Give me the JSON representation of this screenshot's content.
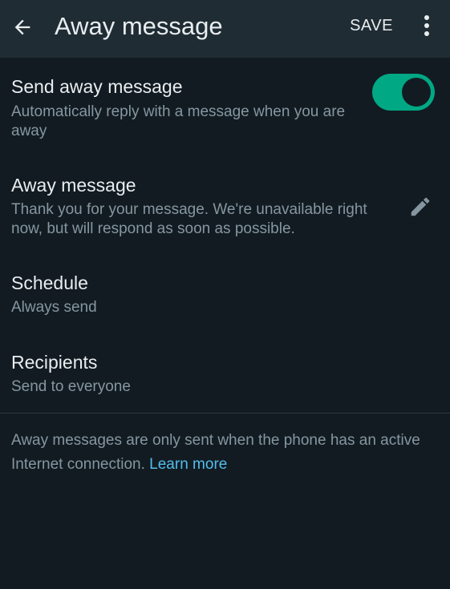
{
  "toolbar": {
    "back_icon": "arrow-left-icon",
    "title": "Away message",
    "save_label": "SAVE",
    "more_icon": "more-vertical-icon"
  },
  "send_away": {
    "title": "Send away message",
    "subtitle": "Automatically reply with a message when you are away",
    "enabled": true
  },
  "away_message": {
    "title": "Away message",
    "text": "Thank you for your message. We're unavailable right now, but will respond as soon as possible.",
    "edit_icon": "pencil-icon"
  },
  "schedule": {
    "title": "Schedule",
    "value": "Always send"
  },
  "recipients": {
    "title": "Recipients",
    "value": "Send to everyone"
  },
  "footer": {
    "note": "Away messages are only sent when the phone has an active Internet connection.",
    "link_label": "Learn more"
  },
  "colors": {
    "background": "#121b22",
    "toolbar": "#1f2c34",
    "accent": "#00a884",
    "link": "#53bdeb",
    "secondary_text": "#8696a0"
  }
}
